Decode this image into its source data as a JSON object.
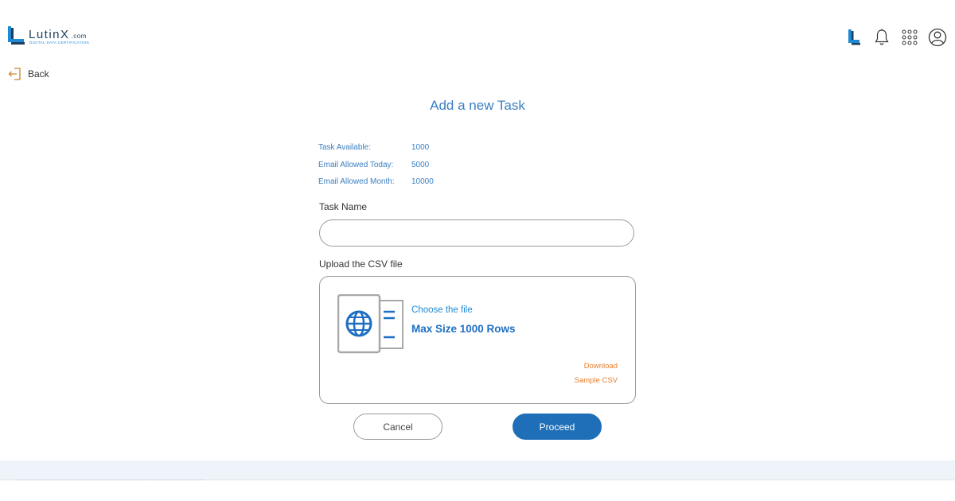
{
  "header": {
    "logo_text": "LutinX",
    "logo_domain": ".com",
    "logo_tagline": "DIGITAL DATA CERTIFICATION",
    "icons": [
      "lutinx-logo-icon",
      "bell-icon",
      "apps-grid-icon",
      "user-avatar-icon"
    ]
  },
  "nav": {
    "back_label": "Back",
    "back_icon": "back-arrow-icon"
  },
  "page": {
    "title": "Add a new Task"
  },
  "stats": [
    {
      "label": "Task Available:",
      "value": "1000"
    },
    {
      "label": "Email Allowed Today:",
      "value": "5000"
    },
    {
      "label": "Email Allowed Month:",
      "value": "10000"
    }
  ],
  "form": {
    "task_name_label": "Task Name",
    "task_name_value": "",
    "task_name_placeholder": "",
    "csv_label": "Upload the CSV file",
    "upload": {
      "icon": "file-globe-icon",
      "choose_text": "Choose the file",
      "max_size_text": "Max Size 1000 Rows",
      "download_line1": "Download",
      "download_line2": "Sample CSV"
    },
    "cancel_label": "Cancel",
    "proceed_label": "Proceed"
  },
  "colors": {
    "accent": "#3b7fc1",
    "primary_button": "#1e6fb8",
    "link_orange": "#e87c2a",
    "brand_blue": "#1f89d4",
    "footer_band": "#eef4f9"
  }
}
